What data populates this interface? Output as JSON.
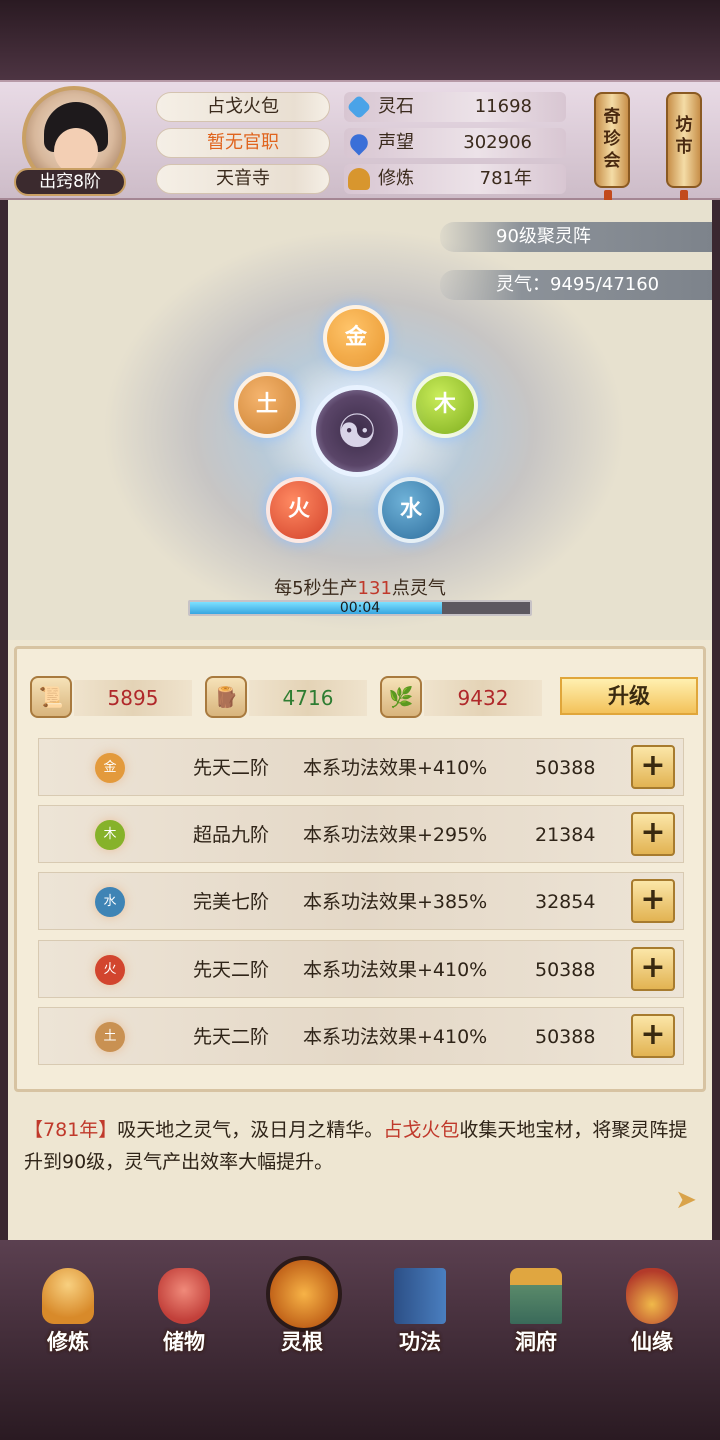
{
  "header": {
    "rank": "出窍8阶",
    "name": "占戈火包",
    "office": "暂无官职",
    "sect": "天音寺",
    "stats": [
      {
        "icon": "spirit-stone-icon",
        "label": "灵石",
        "value": "11698",
        "color": "#4aa3e8"
      },
      {
        "icon": "reputation-icon",
        "label": "声望",
        "value": "302906",
        "color": "#3a6fd8"
      },
      {
        "icon": "cultivation-icon",
        "label": "修炼",
        "value": "781年",
        "color": "#d8962e"
      }
    ],
    "scroll_left": "奇珍会",
    "scroll_right": "坊市"
  },
  "array": {
    "title": "90级聚灵阵",
    "qi": "灵气：9495/47160",
    "elements": [
      {
        "char": "金",
        "color": "#e8962e"
      },
      {
        "char": "木",
        "color": "#7fae1e"
      },
      {
        "char": "水",
        "color": "#3a7fb0"
      },
      {
        "char": "火",
        "color": "#d2412a"
      },
      {
        "char": "土",
        "color": "#d08a3a"
      }
    ],
    "center_symbol": "☯",
    "production_prefix": "每5秒生产",
    "production_value": "131",
    "production_suffix": "点灵气",
    "timer": "00:04",
    "progress": 0.74
  },
  "resources": [
    {
      "icon": "material-scroll-icon",
      "value": "5895",
      "color": "#b0282a"
    },
    {
      "icon": "wood-logs-icon",
      "value": "4716",
      "color": "#2e7d32"
    },
    {
      "icon": "herb-icon",
      "value": "9432",
      "color": "#b0282a"
    }
  ],
  "upgrade_label": "升级",
  "roots": [
    {
      "element": "金",
      "tier": "先天二阶",
      "effect": "本系功法效果+410%",
      "value": "50388",
      "color": "#e39a3c"
    },
    {
      "element": "木",
      "tier": "超品九阶",
      "effect": "本系功法效果+295%",
      "value": "21384",
      "color": "#86b22a"
    },
    {
      "element": "水",
      "tier": "完美七阶",
      "effect": "本系功法效果+385%",
      "value": "32854",
      "color": "#3f84b5"
    },
    {
      "element": "火",
      "tier": "先天二阶",
      "effect": "本系功法效果+410%",
      "value": "50388",
      "color": "#d2452e"
    },
    {
      "element": "土",
      "tier": "先天二阶",
      "effect": "本系功法效果+410%",
      "value": "50388",
      "color": "#c99152"
    }
  ],
  "plus_label": "+",
  "log": {
    "bracket_open": "【",
    "year": "781年",
    "bracket_close": "】",
    "text1": "吸天地之灵气，汲日月之精华。",
    "name": "占戈火包",
    "text2": "收集天地宝材，将聚灵阵提升到90级，灵气产出效率大幅提升。"
  },
  "nav": [
    {
      "id": "xiulian",
      "label": "修炼",
      "icon": "meditating-monk-icon",
      "color": "#d88a2a"
    },
    {
      "id": "chuwu",
      "label": "储物",
      "icon": "storage-bag-icon",
      "color": "#c2403a"
    },
    {
      "id": "linggen",
      "label": "灵根",
      "icon": "spirit-root-icon",
      "color": "#e0862a"
    },
    {
      "id": "gongfa",
      "label": "功法",
      "icon": "book-icon",
      "color": "#3a6fb5"
    },
    {
      "id": "dongfu",
      "label": "洞府",
      "icon": "cave-mansion-icon",
      "color": "#8a5a2a"
    },
    {
      "id": "xianyuan",
      "label": "仙缘",
      "icon": "gourd-icon",
      "color": "#b33a2a"
    }
  ]
}
